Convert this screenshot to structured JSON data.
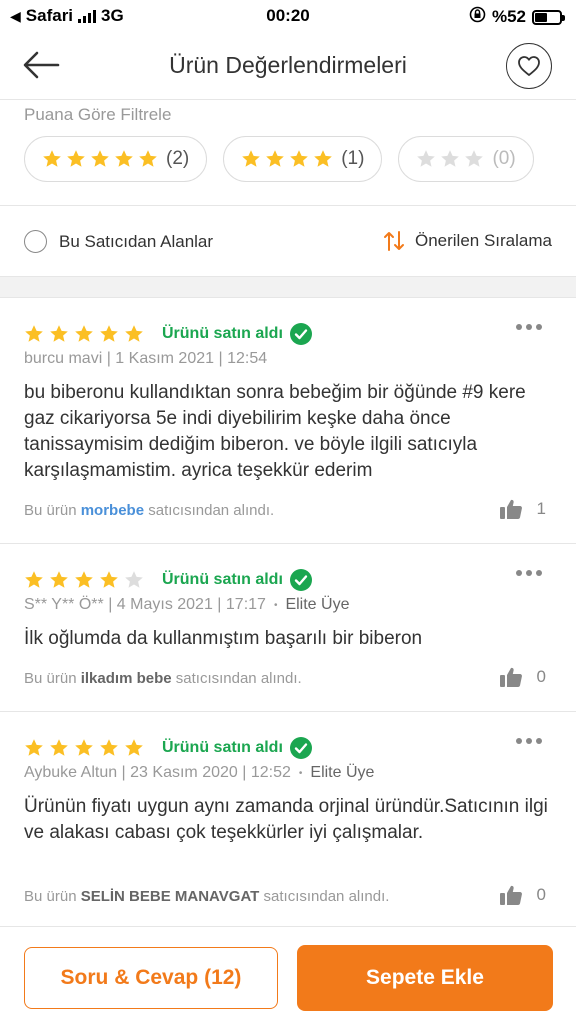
{
  "status_bar": {
    "carrier": "Safari",
    "network": "3G",
    "time": "00:20",
    "battery": "%52",
    "battery_level": 0.52
  },
  "header": {
    "title": "Ürün Değerlendirmeleri",
    "back_icon": "arrow-left-icon",
    "favorite_icon": "heart-icon"
  },
  "filter": {
    "label": "Puana Göre Filtrele",
    "chips": [
      {
        "stars": 5,
        "count": "(2)"
      },
      {
        "stars": 4,
        "count": "(1)"
      },
      {
        "stars": 3,
        "count": "(0)"
      }
    ]
  },
  "options": {
    "seller_only_label": "Bu Satıcıdan Alanlar",
    "sort_label": "Önerilen Sıralama"
  },
  "reviews": [
    {
      "rating": 5,
      "bought_label": "Ürünü satın aldı",
      "meta": "burcu mavi | 1 Kasım 2021 | 12:54",
      "elite": "",
      "text": "bu biberonu kullandıktan sonra bebeğim bir öğünde #9 kere gaz cikariyorsa 5e indi diyebilirim keşke daha önce tanissaymisim dediğim biberon. ve böyle ilgili satıcıyla karşılaşmamistim. ayrica teşekkür ederim",
      "seller_prefix": "Bu ürün",
      "seller_name": "morbebe",
      "seller_suffix": "satıcısından alındı.",
      "likes": "1"
    },
    {
      "rating": 4,
      "bought_label": "Ürünü satın aldı",
      "meta": "S** Y** Ö** | 4 Mayıs 2021 | 17:17",
      "elite": "Elite Üye",
      "text": "İlk oğlumda da kullanmıştım başarılı bir biberon",
      "seller_prefix": "Bu ürün",
      "seller_name": "ilkadım bebe",
      "seller_suffix": "satıcısından alındı.",
      "likes": "0"
    },
    {
      "rating": 5,
      "bought_label": "Ürünü satın aldı",
      "meta": "Aybuke Altun | 23 Kasım 2020 | 12:52",
      "elite": "Elite Üye",
      "text": "Ürünün fiyatı uygun aynı zamanda orjinal üründür.Satıcının ilgi ve alakası cabası çok teşekkürler iyi çalışmalar.",
      "seller_prefix": "Bu ürün",
      "seller_name": "SELİN BEBE MANAVGAT",
      "seller_suffix": "satıcısından alındı.",
      "likes": "0"
    }
  ],
  "bottom": {
    "qa_label": "Soru & Cevap (12)",
    "cart_label": "Sepete Ekle"
  },
  "colors": {
    "accent": "#f27a1a",
    "star": "#fbbf24",
    "star_empty": "#dddddd",
    "bought_green": "#1ba650",
    "seller_blue": "#4a90d9"
  }
}
